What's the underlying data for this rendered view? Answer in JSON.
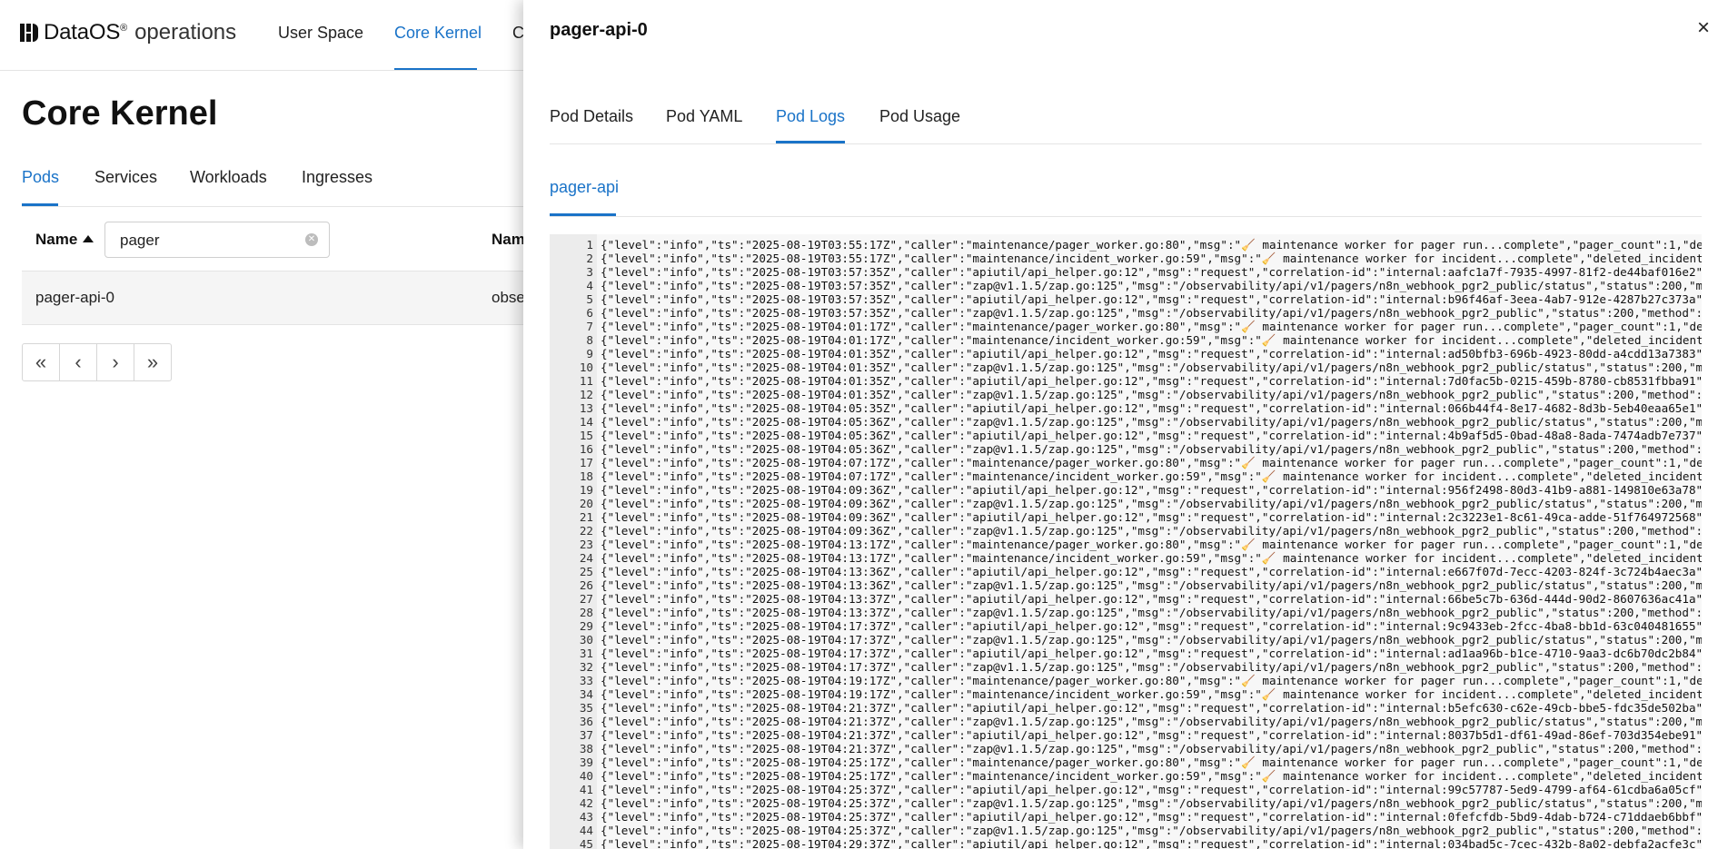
{
  "app": {
    "brand": "DataOS",
    "brand_reg": "®",
    "brand_sub": "operations",
    "nav": [
      "User Space",
      "Core Kernel",
      "C"
    ]
  },
  "page": {
    "title": "Core Kernel",
    "tabs": [
      "Pods",
      "Services",
      "Workloads",
      "Ingresses"
    ],
    "table": {
      "col_name": "Name",
      "col_second": "Nam",
      "filter_value": "pager",
      "rows": [
        {
          "name": "pager-api-0",
          "second": "obse"
        }
      ]
    },
    "pagination": [
      "«",
      "‹",
      "›",
      "»"
    ]
  },
  "drawer": {
    "title": "pager-api-0",
    "close": "×",
    "tabs": [
      "Pod Details",
      "Pod YAML",
      "Pod Logs",
      "Pod Usage"
    ],
    "container_tab": "pager-api",
    "log_lines": [
      "{\"level\":\"info\",\"ts\":\"2025-08-19T03:55:17Z\",\"caller\":\"maintenance/pager_worker.go:80\",\"msg\":\"🧹 maintenance worker for pager run...complete\",\"pager_count\":1,\"de",
      "{\"level\":\"info\",\"ts\":\"2025-08-19T03:55:17Z\",\"caller\":\"maintenance/incident_worker.go:59\",\"msg\":\"🧹 maintenance worker for incident...complete\",\"deleted_incident",
      "{\"level\":\"info\",\"ts\":\"2025-08-19T03:57:35Z\",\"caller\":\"apiutil/api_helper.go:12\",\"msg\":\"request\",\"correlation-id\":\"internal:aafc1a7f-7935-4997-81f2-de44baf016e2\"",
      "{\"level\":\"info\",\"ts\":\"2025-08-19T03:57:35Z\",\"caller\":\"zap@v1.1.5/zap.go:125\",\"msg\":\"/observability/api/v1/pagers/n8n_webhook_pgr2_public/status\",\"status\":200,\"m",
      "{\"level\":\"info\",\"ts\":\"2025-08-19T03:57:35Z\",\"caller\":\"apiutil/api_helper.go:12\",\"msg\":\"request\",\"correlation-id\":\"internal:b96f46af-3eea-4ab7-912e-4287b27c373a\"",
      "{\"level\":\"info\",\"ts\":\"2025-08-19T03:57:35Z\",\"caller\":\"zap@v1.1.5/zap.go:125\",\"msg\":\"/observability/api/v1/pagers/n8n_webhook_pgr2_public\",\"status\":200,\"method\":",
      "{\"level\":\"info\",\"ts\":\"2025-08-19T04:01:17Z\",\"caller\":\"maintenance/pager_worker.go:80\",\"msg\":\"🧹 maintenance worker for pager run...complete\",\"pager_count\":1,\"de",
      "{\"level\":\"info\",\"ts\":\"2025-08-19T04:01:17Z\",\"caller\":\"maintenance/incident_worker.go:59\",\"msg\":\"🧹 maintenance worker for incident...complete\",\"deleted_incident",
      "{\"level\":\"info\",\"ts\":\"2025-08-19T04:01:35Z\",\"caller\":\"apiutil/api_helper.go:12\",\"msg\":\"request\",\"correlation-id\":\"internal:ad50bfb3-696b-4923-80dd-a4cdd13a7383\"",
      "{\"level\":\"info\",\"ts\":\"2025-08-19T04:01:35Z\",\"caller\":\"zap@v1.1.5/zap.go:125\",\"msg\":\"/observability/api/v1/pagers/n8n_webhook_pgr2_public/status\",\"status\":200,\"m",
      "{\"level\":\"info\",\"ts\":\"2025-08-19T04:01:35Z\",\"caller\":\"apiutil/api_helper.go:12\",\"msg\":\"request\",\"correlation-id\":\"internal:7d0fac5b-0215-459b-8780-cb8531fbba91\"",
      "{\"level\":\"info\",\"ts\":\"2025-08-19T04:01:35Z\",\"caller\":\"zap@v1.1.5/zap.go:125\",\"msg\":\"/observability/api/v1/pagers/n8n_webhook_pgr2_public\",\"status\":200,\"method\":",
      "{\"level\":\"info\",\"ts\":\"2025-08-19T04:05:35Z\",\"caller\":\"apiutil/api_helper.go:12\",\"msg\":\"request\",\"correlation-id\":\"internal:066b44f4-8e17-4682-8d3b-5eb40eaa65e1\"",
      "{\"level\":\"info\",\"ts\":\"2025-08-19T04:05:36Z\",\"caller\":\"zap@v1.1.5/zap.go:125\",\"msg\":\"/observability/api/v1/pagers/n8n_webhook_pgr2_public/status\",\"status\":200,\"m",
      "{\"level\":\"info\",\"ts\":\"2025-08-19T04:05:36Z\",\"caller\":\"apiutil/api_helper.go:12\",\"msg\":\"request\",\"correlation-id\":\"internal:4b9af5d5-0bad-48a8-8ada-7474adb7e737\"",
      "{\"level\":\"info\",\"ts\":\"2025-08-19T04:05:36Z\",\"caller\":\"zap@v1.1.5/zap.go:125\",\"msg\":\"/observability/api/v1/pagers/n8n_webhook_pgr2_public\",\"status\":200,\"method\":",
      "{\"level\":\"info\",\"ts\":\"2025-08-19T04:07:17Z\",\"caller\":\"maintenance/pager_worker.go:80\",\"msg\":\"🧹 maintenance worker for pager run...complete\",\"pager_count\":1,\"de",
      "{\"level\":\"info\",\"ts\":\"2025-08-19T04:07:17Z\",\"caller\":\"maintenance/incident_worker.go:59\",\"msg\":\"🧹 maintenance worker for incident...complete\",\"deleted_incident",
      "{\"level\":\"info\",\"ts\":\"2025-08-19T04:09:36Z\",\"caller\":\"apiutil/api_helper.go:12\",\"msg\":\"request\",\"correlation-id\":\"internal:956f2498-80d3-41b9-a881-149810e63a78\"",
      "{\"level\":\"info\",\"ts\":\"2025-08-19T04:09:36Z\",\"caller\":\"zap@v1.1.5/zap.go:125\",\"msg\":\"/observability/api/v1/pagers/n8n_webhook_pgr2_public/status\",\"status\":200,\"m",
      "{\"level\":\"info\",\"ts\":\"2025-08-19T04:09:36Z\",\"caller\":\"apiutil/api_helper.go:12\",\"msg\":\"request\",\"correlation-id\":\"internal:2c3223e1-8c61-49ca-adde-51f764972568\"",
      "{\"level\":\"info\",\"ts\":\"2025-08-19T04:09:36Z\",\"caller\":\"zap@v1.1.5/zap.go:125\",\"msg\":\"/observability/api/v1/pagers/n8n_webhook_pgr2_public\",\"status\":200,\"method\":",
      "{\"level\":\"info\",\"ts\":\"2025-08-19T04:13:17Z\",\"caller\":\"maintenance/pager_worker.go:80\",\"msg\":\"🧹 maintenance worker for pager run...complete\",\"pager_count\":1,\"de",
      "{\"level\":\"info\",\"ts\":\"2025-08-19T04:13:17Z\",\"caller\":\"maintenance/incident_worker.go:59\",\"msg\":\"🧹 maintenance worker for incident...complete\",\"deleted_incident",
      "{\"level\":\"info\",\"ts\":\"2025-08-19T04:13:36Z\",\"caller\":\"apiutil/api_helper.go:12\",\"msg\":\"request\",\"correlation-id\":\"internal:e667f07d-7ecc-4203-824f-3c724b4aec3a\"",
      "{\"level\":\"info\",\"ts\":\"2025-08-19T04:13:36Z\",\"caller\":\"zap@v1.1.5/zap.go:125\",\"msg\":\"/observability/api/v1/pagers/n8n_webhook_pgr2_public/status\",\"status\":200,\"m",
      "{\"level\":\"info\",\"ts\":\"2025-08-19T04:13:37Z\",\"caller\":\"apiutil/api_helper.go:12\",\"msg\":\"request\",\"correlation-id\":\"internal:66be5c7b-636d-444d-90d2-8607636ac41a\"",
      "{\"level\":\"info\",\"ts\":\"2025-08-19T04:13:37Z\",\"caller\":\"zap@v1.1.5/zap.go:125\",\"msg\":\"/observability/api/v1/pagers/n8n_webhook_pgr2_public\",\"status\":200,\"method\":",
      "{\"level\":\"info\",\"ts\":\"2025-08-19T04:17:37Z\",\"caller\":\"apiutil/api_helper.go:12\",\"msg\":\"request\",\"correlation-id\":\"internal:9c9433eb-2fcc-4ba8-bb1d-63c040481655\"",
      "{\"level\":\"info\",\"ts\":\"2025-08-19T04:17:37Z\",\"caller\":\"zap@v1.1.5/zap.go:125\",\"msg\":\"/observability/api/v1/pagers/n8n_webhook_pgr2_public/status\",\"status\":200,\"m",
      "{\"level\":\"info\",\"ts\":\"2025-08-19T04:17:37Z\",\"caller\":\"apiutil/api_helper.go:12\",\"msg\":\"request\",\"correlation-id\":\"internal:ad1aa96b-b1ce-4710-9aa3-dc6b70dc2b84\"",
      "{\"level\":\"info\",\"ts\":\"2025-08-19T04:17:37Z\",\"caller\":\"zap@v1.1.5/zap.go:125\",\"msg\":\"/observability/api/v1/pagers/n8n_webhook_pgr2_public\",\"status\":200,\"method\":",
      "{\"level\":\"info\",\"ts\":\"2025-08-19T04:19:17Z\",\"caller\":\"maintenance/pager_worker.go:80\",\"msg\":\"🧹 maintenance worker for pager run...complete\",\"pager_count\":1,\"de",
      "{\"level\":\"info\",\"ts\":\"2025-08-19T04:19:17Z\",\"caller\":\"maintenance/incident_worker.go:59\",\"msg\":\"🧹 maintenance worker for incident...complete\",\"deleted_incident",
      "{\"level\":\"info\",\"ts\":\"2025-08-19T04:21:37Z\",\"caller\":\"apiutil/api_helper.go:12\",\"msg\":\"request\",\"correlation-id\":\"internal:b5efc630-c62e-49cb-bbe5-fdc35de502ba\"",
      "{\"level\":\"info\",\"ts\":\"2025-08-19T04:21:37Z\",\"caller\":\"zap@v1.1.5/zap.go:125\",\"msg\":\"/observability/api/v1/pagers/n8n_webhook_pgr2_public/status\",\"status\":200,\"m",
      "{\"level\":\"info\",\"ts\":\"2025-08-19T04:21:37Z\",\"caller\":\"apiutil/api_helper.go:12\",\"msg\":\"request\",\"correlation-id\":\"internal:8037b5d1-df61-49ad-86ef-703d354ebe91\"",
      "{\"level\":\"info\",\"ts\":\"2025-08-19T04:21:37Z\",\"caller\":\"zap@v1.1.5/zap.go:125\",\"msg\":\"/observability/api/v1/pagers/n8n_webhook_pgr2_public\",\"status\":200,\"method\":",
      "{\"level\":\"info\",\"ts\":\"2025-08-19T04:25:17Z\",\"caller\":\"maintenance/pager_worker.go:80\",\"msg\":\"🧹 maintenance worker for pager run...complete\",\"pager_count\":1,\"de",
      "{\"level\":\"info\",\"ts\":\"2025-08-19T04:25:17Z\",\"caller\":\"maintenance/incident_worker.go:59\",\"msg\":\"🧹 maintenance worker for incident...complete\",\"deleted_incident",
      "{\"level\":\"info\",\"ts\":\"2025-08-19T04:25:37Z\",\"caller\":\"apiutil/api_helper.go:12\",\"msg\":\"request\",\"correlation-id\":\"internal:99c57787-5ed9-4799-af64-61cdba6a05cf\"",
      "{\"level\":\"info\",\"ts\":\"2025-08-19T04:25:37Z\",\"caller\":\"zap@v1.1.5/zap.go:125\",\"msg\":\"/observability/api/v1/pagers/n8n_webhook_pgr2_public/status\",\"status\":200,\"m",
      "{\"level\":\"info\",\"ts\":\"2025-08-19T04:25:37Z\",\"caller\":\"apiutil/api_helper.go:12\",\"msg\":\"request\",\"correlation-id\":\"internal:0fefcfdb-5bd9-4dab-b724-c71ddaeb6bbf\"",
      "{\"level\":\"info\",\"ts\":\"2025-08-19T04:25:37Z\",\"caller\":\"zap@v1.1.5/zap.go:125\",\"msg\":\"/observability/api/v1/pagers/n8n_webhook_pgr2_public\",\"status\":200,\"method\":",
      "{\"level\":\"info\",\"ts\":\"2025-08-19T04:29:37Z\",\"caller\":\"apiutil/api_helper.go:12\",\"msg\":\"request\",\"correlation-id\":\"internal:034bad5c-7cec-432b-8a02-debfa2acfe3c\""
    ]
  },
  "colors": {
    "accent": "#1a73c8",
    "text": "#222222",
    "row_highlight": "#f5f5f5",
    "log_background": "#f7f7f7"
  }
}
